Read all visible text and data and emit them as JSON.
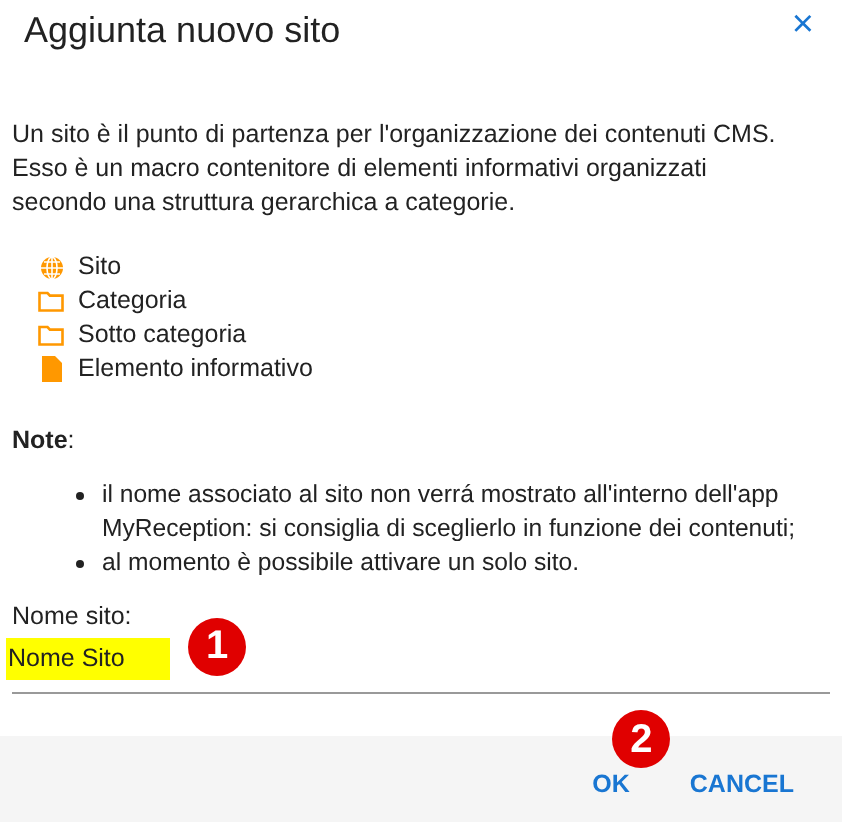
{
  "dialog": {
    "title": "Aggiunta nuovo sito",
    "close": "×"
  },
  "description": "Un sito è il punto di partenza per l'organizzazione dei contenuti CMS. Esso è un macro contenitore di elementi informativi organizzati secondo una struttura gerarchica a categorie.",
  "legend": [
    {
      "kind": "globe",
      "label": "Sito"
    },
    {
      "kind": "folder",
      "label": "Categoria"
    },
    {
      "kind": "folder",
      "label": "Sotto categoria"
    },
    {
      "kind": "file",
      "label": "Elemento informativo"
    }
  ],
  "note": {
    "title": "**Note**:",
    "items": [
      "il nome associato al sito non verrá mostrato all'interno dell'app MyReception: si consiglia di sceglierlo in funzione dei contenuti;",
      "al momento è possibile attivare un solo sito."
    ]
  },
  "field": {
    "label": "Nome sito:",
    "value": "Nome Sito",
    "callout": "1"
  },
  "buttons": [
    {
      "label": "OK",
      "callout": "2"
    },
    {
      "label": "CANCEL"
    }
  ]
}
